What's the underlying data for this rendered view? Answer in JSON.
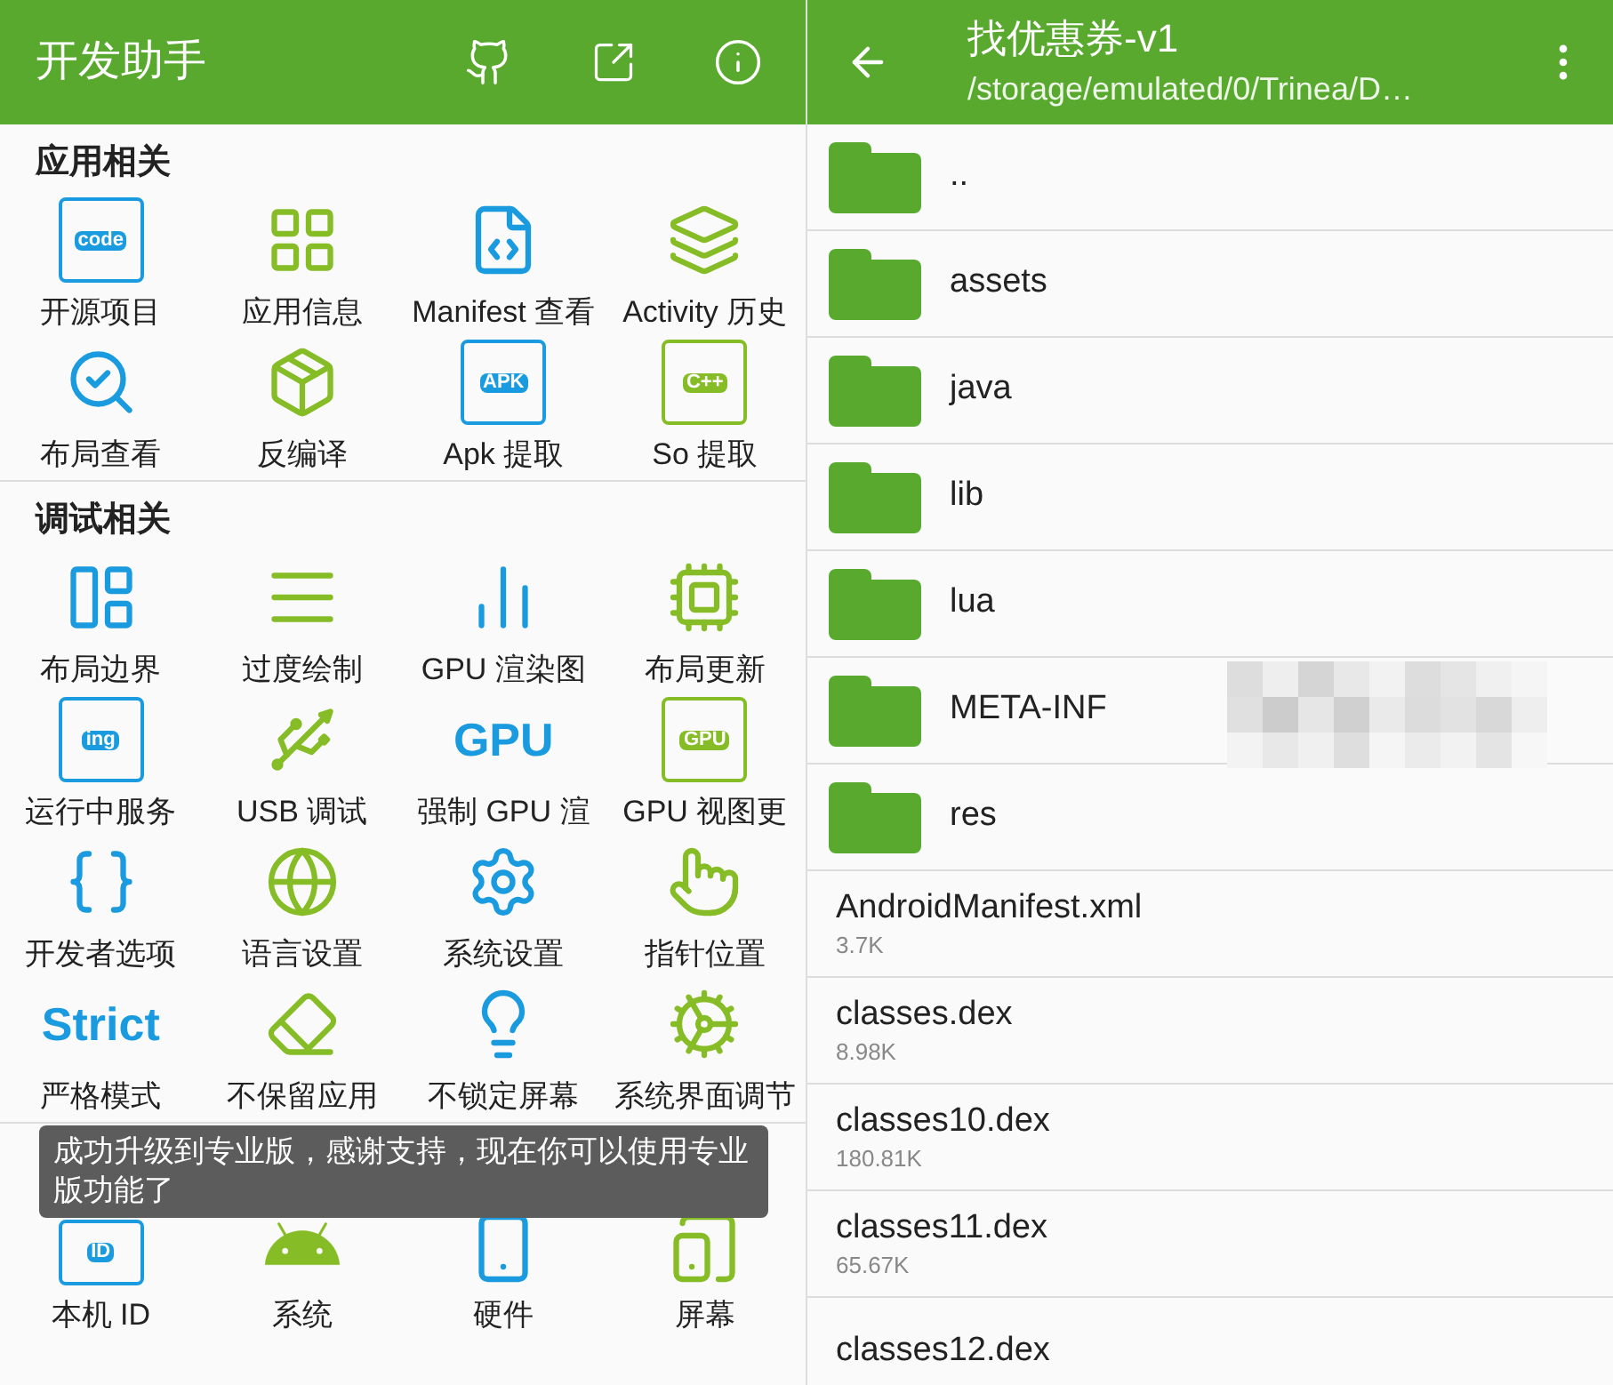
{
  "left_screen": {
    "app_bar": {
      "title": "开发助手"
    },
    "sections": [
      {
        "title": "应用相关",
        "items": [
          {
            "label": "开源项目",
            "icon_text": "code"
          },
          {
            "label": "应用信息"
          },
          {
            "label": "Manifest 查看"
          },
          {
            "label": "Activity 历史"
          },
          {
            "label": "布局查看"
          },
          {
            "label": "反编译"
          },
          {
            "label": "Apk 提取",
            "icon_text": "APK"
          },
          {
            "label": "So 提取",
            "icon_text": "C++"
          }
        ]
      },
      {
        "title": "调试相关",
        "items": [
          {
            "label": "布局边界"
          },
          {
            "label": "过度绘制"
          },
          {
            "label": "GPU 渲染图"
          },
          {
            "label": "布局更新"
          },
          {
            "label": "运行中服务",
            "icon_text": "ing"
          },
          {
            "label": "USB 调试"
          },
          {
            "label": "强制 GPU 渲",
            "icon_text": "GPU"
          },
          {
            "label": "GPU 视图更",
            "icon_text": "GPU"
          },
          {
            "label": "开发者选项"
          },
          {
            "label": "语言设置"
          },
          {
            "label": "系统设置"
          },
          {
            "label": "指针位置"
          },
          {
            "label": "严格模式",
            "icon_text": "Strict"
          },
          {
            "label": "不保留应用"
          },
          {
            "label": "不锁定屏幕"
          },
          {
            "label": "系统界面调节"
          }
        ]
      },
      {
        "items": [
          {
            "label": "本机 ID",
            "icon_text": "ID"
          },
          {
            "label": "系统"
          },
          {
            "label": "硬件"
          },
          {
            "label": "屏幕"
          }
        ]
      }
    ],
    "toast": "成功升级到专业版，感谢支持，现在你可以使用专业版功能了"
  },
  "right_screen": {
    "app_bar": {
      "title": "找优惠券-v1",
      "subtitle": "/storage/emulated/0/Trinea/D…"
    },
    "entries": [
      {
        "kind": "folder",
        "name": ".."
      },
      {
        "kind": "folder",
        "name": "assets"
      },
      {
        "kind": "folder",
        "name": "java"
      },
      {
        "kind": "folder",
        "name": "lib"
      },
      {
        "kind": "folder",
        "name": "lua"
      },
      {
        "kind": "folder",
        "name": "META-INF"
      },
      {
        "kind": "folder",
        "name": "res"
      },
      {
        "kind": "file",
        "name": "AndroidManifest.xml",
        "size": "3.7K"
      },
      {
        "kind": "file",
        "name": "classes.dex",
        "size": "8.98K"
      },
      {
        "kind": "file",
        "name": "classes10.dex",
        "size": "180.81K"
      },
      {
        "kind": "file",
        "name": "classes11.dex",
        "size": "65.67K"
      },
      {
        "kind": "file",
        "name": "classes12.dex"
      }
    ]
  }
}
